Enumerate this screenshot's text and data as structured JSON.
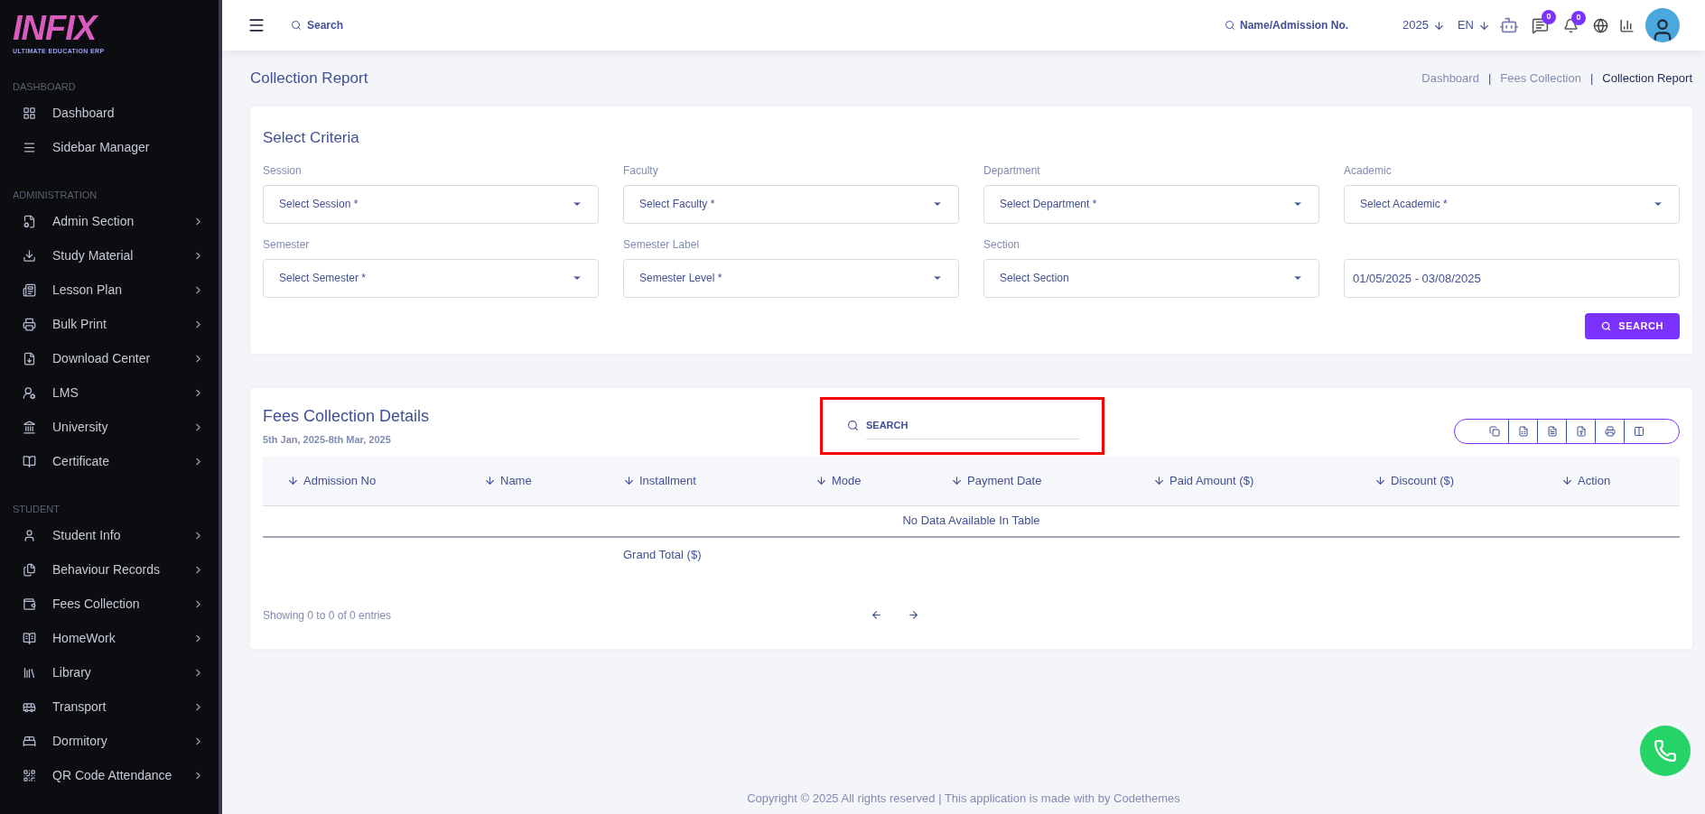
{
  "sidebar": {
    "logo": {
      "text": "INFIX",
      "subtitle": "ULTIMATE EDUCATION ERP"
    },
    "sections": [
      {
        "title": "DASHBOARD",
        "items": [
          {
            "label": "Dashboard",
            "expandable": false
          },
          {
            "label": "Sidebar Manager",
            "expandable": false
          }
        ]
      },
      {
        "title": "ADMINISTRATION",
        "items": [
          {
            "label": "Admin Section",
            "expandable": true
          },
          {
            "label": "Study Material",
            "expandable": true
          },
          {
            "label": "Lesson Plan",
            "expandable": true
          },
          {
            "label": "Bulk Print",
            "expandable": true
          },
          {
            "label": "Download Center",
            "expandable": true
          },
          {
            "label": "LMS",
            "expandable": true
          },
          {
            "label": "University",
            "expandable": true
          },
          {
            "label": "Certificate",
            "expandable": true
          }
        ]
      },
      {
        "title": "STUDENT",
        "items": [
          {
            "label": "Student Info",
            "expandable": true
          },
          {
            "label": "Behaviour Records",
            "expandable": true
          },
          {
            "label": "Fees Collection",
            "expandable": true
          },
          {
            "label": "HomeWork",
            "expandable": true
          },
          {
            "label": "Library",
            "expandable": true
          },
          {
            "label": "Transport",
            "expandable": true
          },
          {
            "label": "Dormitory",
            "expandable": true
          },
          {
            "label": "QR Code Attendance",
            "expandable": true
          }
        ]
      }
    ]
  },
  "header": {
    "search": {
      "placeholder": "Search"
    },
    "student_search": {
      "placeholder": "Name/Admission No."
    },
    "year": "2025",
    "language": "EN",
    "message_count": "0",
    "notification_count": "0"
  },
  "page": {
    "title": "Collection Report",
    "separator": "|",
    "breadcrumbs": [
      {
        "label": "Dashboard",
        "selected": false
      },
      {
        "label": "Fees Collection",
        "selected": false
      },
      {
        "label": "Collection Report",
        "selected": true
      }
    ]
  },
  "criteria": {
    "title": "Select Criteria",
    "fields": [
      {
        "kind": "select",
        "label": "Session",
        "placeholder": "Select Session *"
      },
      {
        "kind": "select",
        "label": "Faculty",
        "placeholder": "Select Faculty *"
      },
      {
        "kind": "select",
        "label": "Department",
        "placeholder": "Select Department *"
      },
      {
        "kind": "select",
        "label": "Academic",
        "placeholder": "Select Academic *"
      },
      {
        "kind": "select",
        "label": "Semester",
        "placeholder": "Select Semester *"
      },
      {
        "kind": "select",
        "label": "Semester Label",
        "placeholder": "Semester Level *"
      },
      {
        "kind": "select",
        "label": "Section",
        "placeholder": "Select Section"
      },
      {
        "kind": "date",
        "value": "01/05/2025 - 03/08/2025"
      }
    ],
    "button": "SEARCH"
  },
  "details": {
    "title": "Fees Collection Details",
    "date_range": "5th Jan, 2025-8th Mar, 2025",
    "search": {
      "placeholder": "SEARCH",
      "highlighted": true
    },
    "columns": [
      "Admission No",
      "Name",
      "Installment",
      "Mode",
      "Payment Date",
      "Paid Amount ($)",
      "Discount ($)",
      "Action"
    ],
    "empty_message": "No Data Available In Table",
    "grand_total_label": "Grand Total ($)",
    "info": "Showing 0 to 0 of 0 entries"
  },
  "footer": "Copyright © 2025 All rights reserved | This application is made with by Codethemes"
}
